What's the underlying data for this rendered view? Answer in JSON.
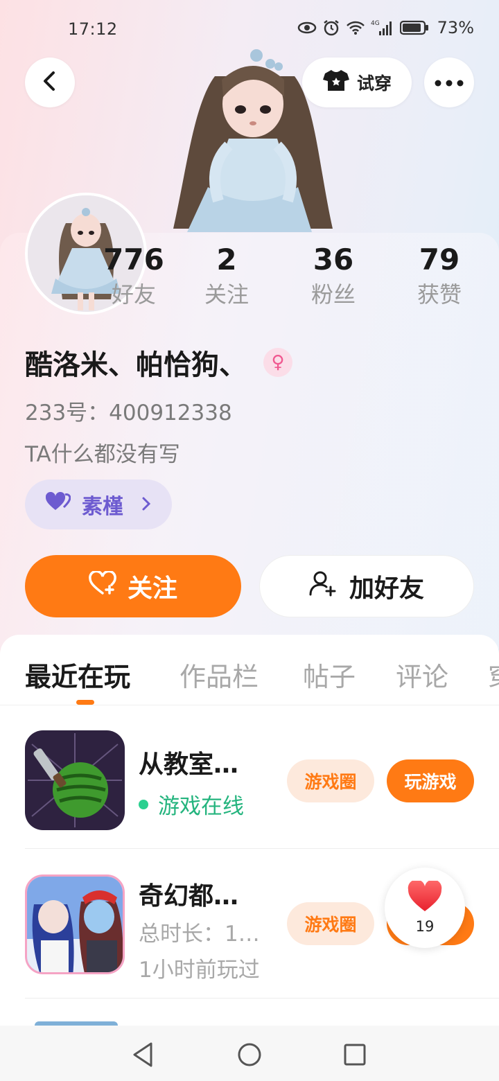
{
  "status_bar": {
    "time": "17:12",
    "battery": "73%",
    "network": "4G"
  },
  "header": {
    "try_on_label": "试穿"
  },
  "stats": [
    {
      "value": "776",
      "label": "好友"
    },
    {
      "value": "2",
      "label": "关注"
    },
    {
      "value": "36",
      "label": "粉丝"
    },
    {
      "value": "79",
      "label": "获赞"
    }
  ],
  "profile": {
    "nickname": "酷洛米、帕恰狗、",
    "gender_symbol": "♀",
    "uid_line": "233号：400912338",
    "bio": "TA什么都没有写",
    "tag_label": "素槿"
  },
  "actions": {
    "follow_label": "关注",
    "add_friend_label": "加好友"
  },
  "tabs": [
    "最近在玩",
    "作品栏",
    "帖子",
    "评论",
    "穿"
  ],
  "games": [
    {
      "title": "从教室…",
      "status": "游戏在线",
      "circle_label": "游戏圈",
      "play_label": "玩游戏"
    },
    {
      "title": "奇幻都…",
      "duration": "总时长：1…",
      "last_played": "1小时前玩过",
      "circle_label": "游戏圈"
    }
  ],
  "like_bubble": {
    "count": "19"
  },
  "colors": {
    "accent": "#ff7a14",
    "online": "#24b47e",
    "tag": "#6d5bd0"
  }
}
